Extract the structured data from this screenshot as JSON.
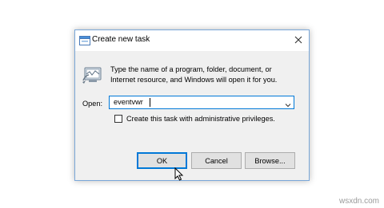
{
  "dialog": {
    "title": "Create new task",
    "description_line1": "Type the name of a program, folder, document, or",
    "description_line2": "Internet resource, and Windows will open it for you.",
    "open_label": "Open:",
    "open_value": "eventvwr",
    "checkbox_label": "Create this task with administrative privileges.",
    "checkbox_checked": false,
    "buttons": {
      "ok": "OK",
      "cancel": "Cancel",
      "browse": "Browse..."
    }
  },
  "icons": {
    "title": "run-window-icon",
    "body": "run-program-icon",
    "close": "close-icon",
    "dropdown": "chevron-down-icon",
    "cursor": "mouse-pointer-icon"
  },
  "colors": {
    "accent": "#0078d7",
    "dialog_bg": "#f0f0f0",
    "button_bg": "#e1e1e1"
  },
  "watermark": "wsxdn.com"
}
